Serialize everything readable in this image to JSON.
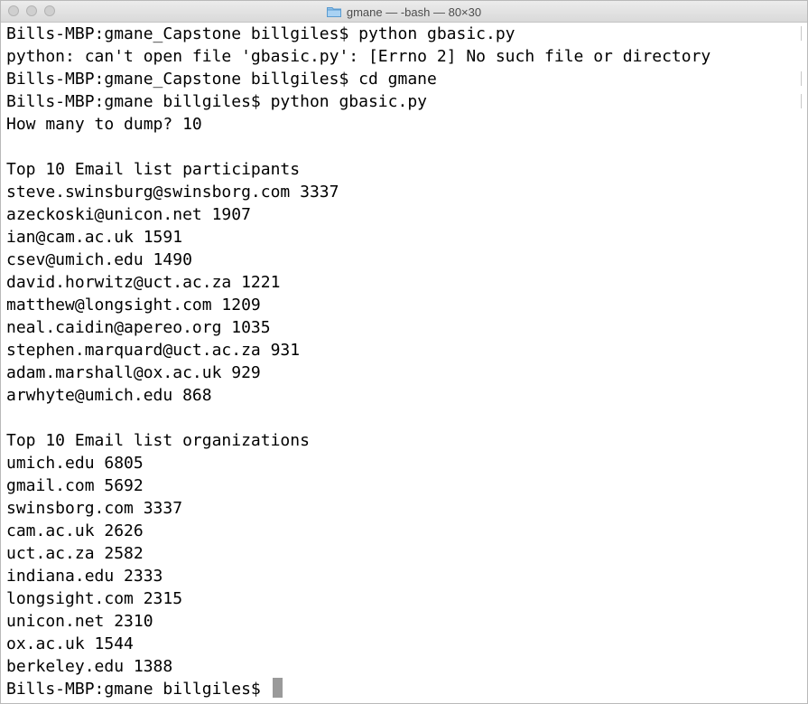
{
  "window": {
    "title": "gmane — -bash — 80×30"
  },
  "terminal": {
    "lines": [
      "Bills-MBP:gmane_Capstone billgiles$ python gbasic.py",
      "python: can't open file 'gbasic.py': [Errno 2] No such file or directory",
      "Bills-MBP:gmane_Capstone billgiles$ cd gmane",
      "Bills-MBP:gmane billgiles$ python gbasic.py",
      "How many to dump? 10",
      "",
      "Top 10 Email list participants",
      "steve.swinsburg@swinsborg.com 3337",
      "azeckoski@unicon.net 1907",
      "ian@cam.ac.uk 1591",
      "csev@umich.edu 1490",
      "david.horwitz@uct.ac.za 1221",
      "matthew@longsight.com 1209",
      "neal.caidin@apereo.org 1035",
      "stephen.marquard@uct.ac.za 931",
      "adam.marshall@ox.ac.uk 929",
      "arwhyte@umich.edu 868",
      "",
      "Top 10 Email list organizations",
      "umich.edu 6805",
      "gmail.com 5692",
      "swinsborg.com 3337",
      "cam.ac.uk 2626",
      "uct.ac.za 2582",
      "indiana.edu 2333",
      "longsight.com 2315",
      "unicon.net 2310",
      "ox.ac.uk 1544",
      "berkeley.edu 1388"
    ],
    "prompt": "Bills-MBP:gmane billgiles$ "
  }
}
